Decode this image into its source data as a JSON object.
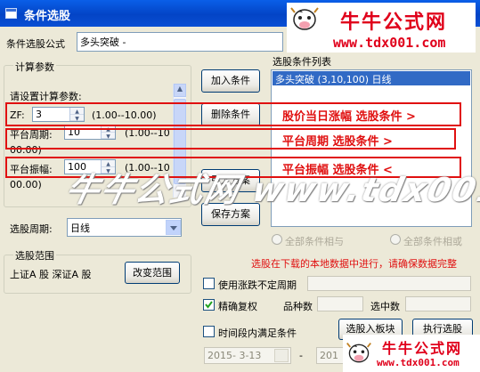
{
  "window": {
    "title": "条件选股"
  },
  "logos": [
    {
      "brand": "牛牛公式网",
      "url": "www.tdx001.com"
    },
    {
      "brand": "牛牛公式网",
      "url": "www.tdx001.com"
    }
  ],
  "formula": {
    "label": "条件选股公式",
    "value": "多头突破 -"
  },
  "params": {
    "group_title": "计算参数",
    "prompt": "请设置计算参数:",
    "rows": [
      {
        "label": "ZF:",
        "value": "3",
        "range": "(1.00--10.00)"
      },
      {
        "label": "平台周期:",
        "value": "10",
        "range": "(1.00--10",
        "range_cont": "00.00)"
      },
      {
        "label": "平台振幅:",
        "value": "100",
        "range": "(1.00--10",
        "range_cont": "00.00)"
      }
    ]
  },
  "period": {
    "label": "选股周期:",
    "value": "日线"
  },
  "scope": {
    "group_title": "选股范围",
    "value": "上证A 股 深证A 股",
    "change_button": "改变范围"
  },
  "buttons": {
    "add": "加入条件",
    "delete": "删除条件",
    "import": "引入方案",
    "save": "保存方案",
    "to_block": "选股入板块",
    "run": "执行选股"
  },
  "condition_list": {
    "title": "选股条件列表",
    "items": [
      "多头突破 (3,10,100) 日线"
    ]
  },
  "annotations": [
    "股价当日涨幅 选股条件 >",
    "平台周期  选股条件 >",
    "平台振幅  选股条件 <"
  ],
  "watermark": "牛牛公式网 www.tdx001.com",
  "logic": {
    "all_and": "全部条件相与",
    "all_or": "全部条件相或"
  },
  "notice": "选股在下载的本地数据中进行，请确保数据完整",
  "options": {
    "unusual_period": "使用涨跌不定周期",
    "exact_rights": "精确复权",
    "time_range": "时间段内满足条件"
  },
  "stats": {
    "variety_label": "品种数",
    "selected_label": "选中数"
  },
  "dates": {
    "start": "2015- 3-13",
    "end": "201"
  }
}
